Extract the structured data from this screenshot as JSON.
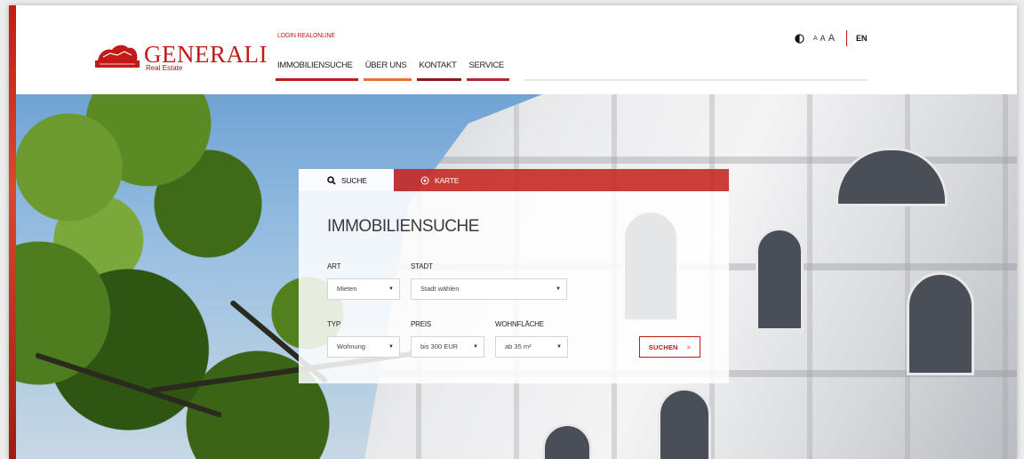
{
  "brand": {
    "name": "GENERALI",
    "sub": "Real Estate",
    "color": "#c21b17"
  },
  "header": {
    "login_link": "LOGIN REALONLINE",
    "nav": [
      {
        "label": "IMMOBILIENSUCHE",
        "accent": "#c21b17"
      },
      {
        "label": "ÜBER UNS",
        "accent": "#e8703a"
      },
      {
        "label": "KONTAKT",
        "accent": "#8a1a17"
      },
      {
        "label": "SERVICE",
        "accent": "#b0243c"
      }
    ],
    "tools": {
      "font_small": "A",
      "font_medium": "A",
      "font_large": "A",
      "language": "EN"
    }
  },
  "search": {
    "tabs": [
      {
        "label": "SUCHE",
        "icon": "search-icon",
        "active": true
      },
      {
        "label": "KARTE",
        "icon": "map-pin-icon",
        "active": false
      }
    ],
    "title": "IMMOBILIENSUCHE",
    "fields": {
      "art": {
        "label": "ART",
        "value": "Mieten"
      },
      "stadt": {
        "label": "STADT",
        "value": "Stadt wählen"
      },
      "typ": {
        "label": "TYP",
        "value": "Wohnung"
      },
      "preis": {
        "label": "PREIS",
        "value": "bis 300 EUR"
      },
      "wohnflaeche": {
        "label": "WOHNFLÄCHE",
        "value": "ab 35 m²"
      }
    },
    "submit_label": "SUCHEN",
    "submit_chevron": ">"
  },
  "colors": {
    "accent_red": "#c21b17",
    "tab_red": "#c62420"
  }
}
